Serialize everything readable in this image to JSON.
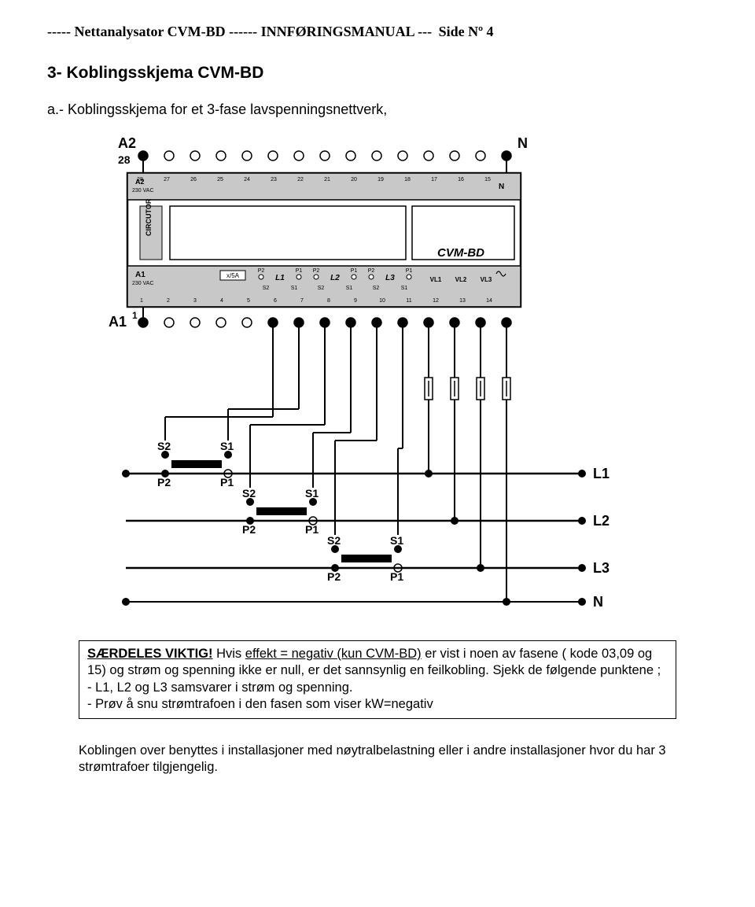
{
  "header": {
    "left": "----- Nettanalysator CVM-BD ------   INNFØRINGSMANUAL ---",
    "right": "Side  Nº 4"
  },
  "section_title": "3- Koblingsskjema CVM-BD",
  "subtitle": "a.- Koblingsskjema for et 3-fase lavspenningsnettverk,",
  "diagram": {
    "outer": {
      "A2_top": "A2",
      "N_top": "N",
      "A1_left": "A1",
      "t28": "28"
    },
    "device": {
      "A2": "A2",
      "N": "N",
      "A1": "A1",
      "ac_top": "230 VAC",
      "ac_bottom": "230 VAC",
      "brand": "CIRCUTOR",
      "model": "CVM-BD",
      "x5a": "x/5A",
      "L1": "L1",
      "L2": "L2",
      "L3": "L3",
      "VL1": "VL1",
      "VL2": "VL2",
      "VL3": "VL3",
      "sp": {
        "S1": "S1",
        "S2": "S2",
        "P1": "P1",
        "P2": "P2"
      },
      "top_nums": [
        "28",
        "27",
        "26",
        "25",
        "24",
        "23",
        "22",
        "21",
        "20",
        "19",
        "18",
        "17",
        "16",
        "15"
      ],
      "bot_nums": [
        "1",
        "2",
        "3",
        "4",
        "5",
        "6",
        "7",
        "8",
        "9",
        "10",
        "11",
        "12",
        "13",
        "14"
      ]
    },
    "ct": {
      "S2": "S2",
      "S1": "S1",
      "P2": "P2",
      "P1": "P1"
    },
    "lines": {
      "L1": "L1",
      "L2": "L2",
      "L3": "L3",
      "N": "N"
    }
  },
  "important": {
    "title": "SÆRDELES VIKTIG!",
    "sentence": " Hvis ",
    "ul": "effekt = negativ (kun CVM-BD)",
    "rest1": " er vist i noen av fasene ( kode 03,09 og 15) og strøm og spenning ikke er null, er det sannsynlig en feilkobling. Sjekk de følgende punktene ;",
    "b1": "  - L1, L2 og L3 samsvarer i strøm og spenning.",
    "b2": "  - Prøv å snu strømtrafoen i den fasen som viser kW=negativ"
  },
  "para": "Koblingen over benyttes i installasjoner med nøytralbelastning eller i andre installasjoner hvor du har 3 strømtrafoer tilgjengelig."
}
